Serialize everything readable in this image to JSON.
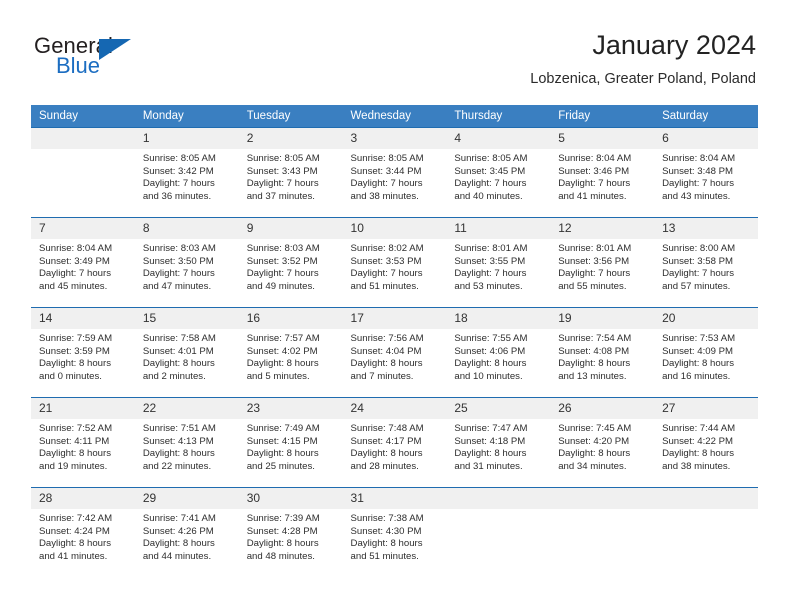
{
  "brand": {
    "name_part1": "General",
    "name_part2": "Blue",
    "triangle_icon": "triangle-icon",
    "accent_color": "#1567b2"
  },
  "header": {
    "title": "January 2024",
    "subtitle": "Lobzenica, Greater Poland, Poland"
  },
  "calendar": {
    "header_bg_color": "#3a7fc1",
    "row_border_color": "#1f6cb0",
    "daynum_bg_color": "#f0f0f0",
    "weekday_headers": [
      "Sunday",
      "Monday",
      "Tuesday",
      "Wednesday",
      "Thursday",
      "Friday",
      "Saturday"
    ],
    "labels": {
      "sunrise": "Sunrise:",
      "sunset": "Sunset:",
      "daylight": "Daylight:"
    },
    "weeks": [
      [
        {
          "day": "",
          "sunrise": "",
          "sunset": "",
          "daylight_l1": "",
          "daylight_l2": ""
        },
        {
          "day": "1",
          "sunrise": "Sunrise: 8:05 AM",
          "sunset": "Sunset: 3:42 PM",
          "daylight_l1": "Daylight: 7 hours",
          "daylight_l2": "and 36 minutes."
        },
        {
          "day": "2",
          "sunrise": "Sunrise: 8:05 AM",
          "sunset": "Sunset: 3:43 PM",
          "daylight_l1": "Daylight: 7 hours",
          "daylight_l2": "and 37 minutes."
        },
        {
          "day": "3",
          "sunrise": "Sunrise: 8:05 AM",
          "sunset": "Sunset: 3:44 PM",
          "daylight_l1": "Daylight: 7 hours",
          "daylight_l2": "and 38 minutes."
        },
        {
          "day": "4",
          "sunrise": "Sunrise: 8:05 AM",
          "sunset": "Sunset: 3:45 PM",
          "daylight_l1": "Daylight: 7 hours",
          "daylight_l2": "and 40 minutes."
        },
        {
          "day": "5",
          "sunrise": "Sunrise: 8:04 AM",
          "sunset": "Sunset: 3:46 PM",
          "daylight_l1": "Daylight: 7 hours",
          "daylight_l2": "and 41 minutes."
        },
        {
          "day": "6",
          "sunrise": "Sunrise: 8:04 AM",
          "sunset": "Sunset: 3:48 PM",
          "daylight_l1": "Daylight: 7 hours",
          "daylight_l2": "and 43 minutes."
        }
      ],
      [
        {
          "day": "7",
          "sunrise": "Sunrise: 8:04 AM",
          "sunset": "Sunset: 3:49 PM",
          "daylight_l1": "Daylight: 7 hours",
          "daylight_l2": "and 45 minutes."
        },
        {
          "day": "8",
          "sunrise": "Sunrise: 8:03 AM",
          "sunset": "Sunset: 3:50 PM",
          "daylight_l1": "Daylight: 7 hours",
          "daylight_l2": "and 47 minutes."
        },
        {
          "day": "9",
          "sunrise": "Sunrise: 8:03 AM",
          "sunset": "Sunset: 3:52 PM",
          "daylight_l1": "Daylight: 7 hours",
          "daylight_l2": "and 49 minutes."
        },
        {
          "day": "10",
          "sunrise": "Sunrise: 8:02 AM",
          "sunset": "Sunset: 3:53 PM",
          "daylight_l1": "Daylight: 7 hours",
          "daylight_l2": "and 51 minutes."
        },
        {
          "day": "11",
          "sunrise": "Sunrise: 8:01 AM",
          "sunset": "Sunset: 3:55 PM",
          "daylight_l1": "Daylight: 7 hours",
          "daylight_l2": "and 53 minutes."
        },
        {
          "day": "12",
          "sunrise": "Sunrise: 8:01 AM",
          "sunset": "Sunset: 3:56 PM",
          "daylight_l1": "Daylight: 7 hours",
          "daylight_l2": "and 55 minutes."
        },
        {
          "day": "13",
          "sunrise": "Sunrise: 8:00 AM",
          "sunset": "Sunset: 3:58 PM",
          "daylight_l1": "Daylight: 7 hours",
          "daylight_l2": "and 57 minutes."
        }
      ],
      [
        {
          "day": "14",
          "sunrise": "Sunrise: 7:59 AM",
          "sunset": "Sunset: 3:59 PM",
          "daylight_l1": "Daylight: 8 hours",
          "daylight_l2": "and 0 minutes."
        },
        {
          "day": "15",
          "sunrise": "Sunrise: 7:58 AM",
          "sunset": "Sunset: 4:01 PM",
          "daylight_l1": "Daylight: 8 hours",
          "daylight_l2": "and 2 minutes."
        },
        {
          "day": "16",
          "sunrise": "Sunrise: 7:57 AM",
          "sunset": "Sunset: 4:02 PM",
          "daylight_l1": "Daylight: 8 hours",
          "daylight_l2": "and 5 minutes."
        },
        {
          "day": "17",
          "sunrise": "Sunrise: 7:56 AM",
          "sunset": "Sunset: 4:04 PM",
          "daylight_l1": "Daylight: 8 hours",
          "daylight_l2": "and 7 minutes."
        },
        {
          "day": "18",
          "sunrise": "Sunrise: 7:55 AM",
          "sunset": "Sunset: 4:06 PM",
          "daylight_l1": "Daylight: 8 hours",
          "daylight_l2": "and 10 minutes."
        },
        {
          "day": "19",
          "sunrise": "Sunrise: 7:54 AM",
          "sunset": "Sunset: 4:08 PM",
          "daylight_l1": "Daylight: 8 hours",
          "daylight_l2": "and 13 minutes."
        },
        {
          "day": "20",
          "sunrise": "Sunrise: 7:53 AM",
          "sunset": "Sunset: 4:09 PM",
          "daylight_l1": "Daylight: 8 hours",
          "daylight_l2": "and 16 minutes."
        }
      ],
      [
        {
          "day": "21",
          "sunrise": "Sunrise: 7:52 AM",
          "sunset": "Sunset: 4:11 PM",
          "daylight_l1": "Daylight: 8 hours",
          "daylight_l2": "and 19 minutes."
        },
        {
          "day": "22",
          "sunrise": "Sunrise: 7:51 AM",
          "sunset": "Sunset: 4:13 PM",
          "daylight_l1": "Daylight: 8 hours",
          "daylight_l2": "and 22 minutes."
        },
        {
          "day": "23",
          "sunrise": "Sunrise: 7:49 AM",
          "sunset": "Sunset: 4:15 PM",
          "daylight_l1": "Daylight: 8 hours",
          "daylight_l2": "and 25 minutes."
        },
        {
          "day": "24",
          "sunrise": "Sunrise: 7:48 AM",
          "sunset": "Sunset: 4:17 PM",
          "daylight_l1": "Daylight: 8 hours",
          "daylight_l2": "and 28 minutes."
        },
        {
          "day": "25",
          "sunrise": "Sunrise: 7:47 AM",
          "sunset": "Sunset: 4:18 PM",
          "daylight_l1": "Daylight: 8 hours",
          "daylight_l2": "and 31 minutes."
        },
        {
          "day": "26",
          "sunrise": "Sunrise: 7:45 AM",
          "sunset": "Sunset: 4:20 PM",
          "daylight_l1": "Daylight: 8 hours",
          "daylight_l2": "and 34 minutes."
        },
        {
          "day": "27",
          "sunrise": "Sunrise: 7:44 AM",
          "sunset": "Sunset: 4:22 PM",
          "daylight_l1": "Daylight: 8 hours",
          "daylight_l2": "and 38 minutes."
        }
      ],
      [
        {
          "day": "28",
          "sunrise": "Sunrise: 7:42 AM",
          "sunset": "Sunset: 4:24 PM",
          "daylight_l1": "Daylight: 8 hours",
          "daylight_l2": "and 41 minutes."
        },
        {
          "day": "29",
          "sunrise": "Sunrise: 7:41 AM",
          "sunset": "Sunset: 4:26 PM",
          "daylight_l1": "Daylight: 8 hours",
          "daylight_l2": "and 44 minutes."
        },
        {
          "day": "30",
          "sunrise": "Sunrise: 7:39 AM",
          "sunset": "Sunset: 4:28 PM",
          "daylight_l1": "Daylight: 8 hours",
          "daylight_l2": "and 48 minutes."
        },
        {
          "day": "31",
          "sunrise": "Sunrise: 7:38 AM",
          "sunset": "Sunset: 4:30 PM",
          "daylight_l1": "Daylight: 8 hours",
          "daylight_l2": "and 51 minutes."
        },
        {
          "day": "",
          "sunrise": "",
          "sunset": "",
          "daylight_l1": "",
          "daylight_l2": ""
        },
        {
          "day": "",
          "sunrise": "",
          "sunset": "",
          "daylight_l1": "",
          "daylight_l2": ""
        },
        {
          "day": "",
          "sunrise": "",
          "sunset": "",
          "daylight_l1": "",
          "daylight_l2": ""
        }
      ]
    ]
  }
}
